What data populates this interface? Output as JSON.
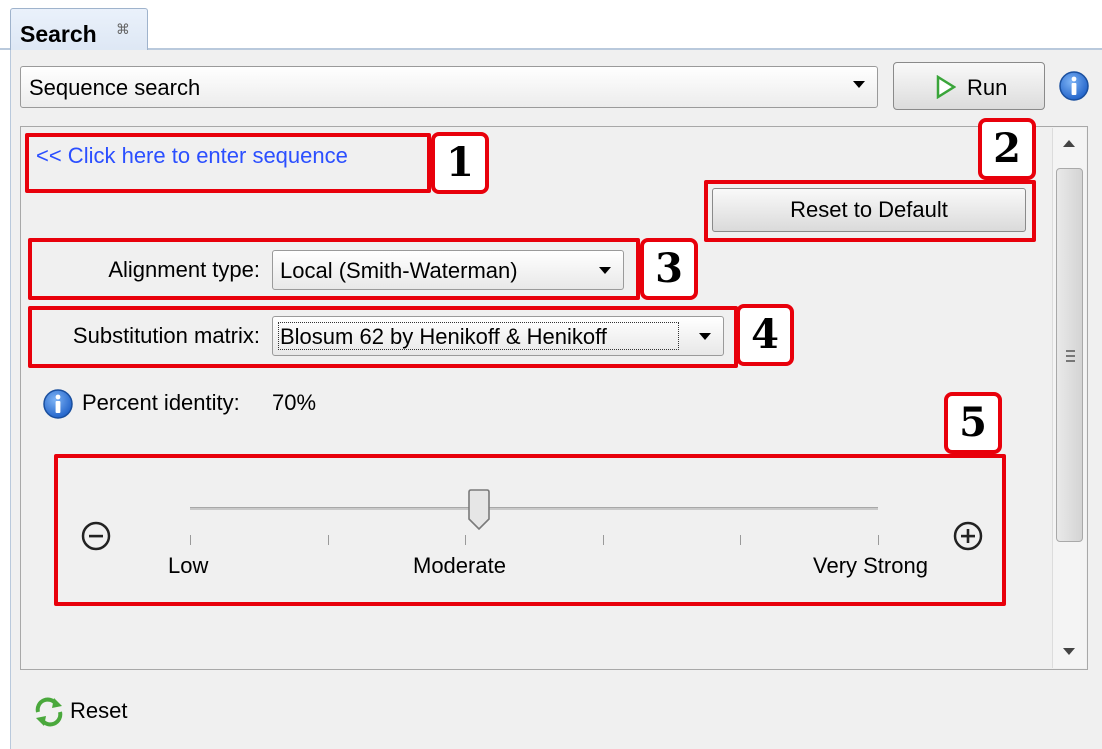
{
  "tab": {
    "title": "Search",
    "close_glyph": "⌘"
  },
  "search_type": {
    "value": "Sequence search"
  },
  "run_button": {
    "label": "Run"
  },
  "enter_sequence_link": "<< Click here to enter sequence",
  "reset_default_button": "Reset to Default",
  "alignment": {
    "label": "Alignment type:",
    "value": "Local (Smith-Waterman)"
  },
  "substitution": {
    "label": "Substitution matrix:",
    "value": "Blosum 62 by Henikoff & Henikoff"
  },
  "percent_identity": {
    "label": "Percent identity:",
    "value": "70%"
  },
  "slider": {
    "labels": {
      "low": "Low",
      "moderate": "Moderate",
      "very_strong": "Very Strong"
    },
    "position": 0.42,
    "tick_count": 6
  },
  "annotations": [
    "1",
    "2",
    "3",
    "4",
    "5"
  ],
  "reset_bottom": "Reset",
  "colors": {
    "annotation": "#e8000b",
    "link": "#2b4fff",
    "info": "#2a6fd6",
    "run_play": "#3aa53a"
  }
}
